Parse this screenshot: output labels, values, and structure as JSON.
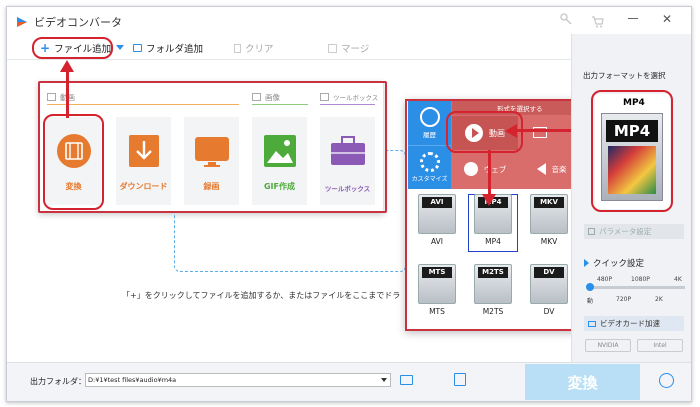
{
  "window": {
    "title": "ビデオコンバータ",
    "accent": "#2b8ee8",
    "highlight": "#d4232f"
  },
  "toolbar": {
    "add_file": "ファイル追加",
    "add_folder": "フォルダ追加",
    "clear": "クリア",
    "merge": "マージ"
  },
  "menu": {
    "categories": {
      "video": "動画",
      "image": "画像",
      "toolbox": "ツールボックス"
    },
    "tiles": [
      {
        "label": "変換",
        "color": "#e67a2e"
      },
      {
        "label": "ダウンロード",
        "color": "#e67a2e"
      },
      {
        "label": "録画",
        "color": "#e67a2e"
      },
      {
        "label": "GIF作成",
        "color": "#4cab3a"
      },
      {
        "label": "ツールボックス",
        "color": "#8a5ab6"
      }
    ]
  },
  "hint": "「+」をクリックしてファイルを追加するか、またはファイルをここまでドラ",
  "formats": {
    "top_label": "形式を選択する",
    "side": {
      "history": "履歴",
      "custom": "カスタマイズ"
    },
    "types": {
      "video": "動画",
      "web": "ウェブ",
      "audio": "音楽"
    },
    "items": [
      "AVI",
      "MP4",
      "MKV",
      "MTS",
      "M2TS",
      "DV"
    ]
  },
  "right": {
    "heading": "出力フォーマットを選択",
    "format": "MP4",
    "params": "パラメータ設定",
    "quick": "クイック設定",
    "res_top": [
      "480P",
      "1080P",
      "4K"
    ],
    "res_bottom": [
      "動",
      "720P",
      "2K"
    ],
    "hw": "ビデオカード加速",
    "nvidia": "NVIDIA",
    "intel": "Intel"
  },
  "bottom": {
    "folder_label": "出力フォルダ：",
    "folder_value": "D:¥1¥test files¥audio¥m4a",
    "convert": "変換"
  }
}
